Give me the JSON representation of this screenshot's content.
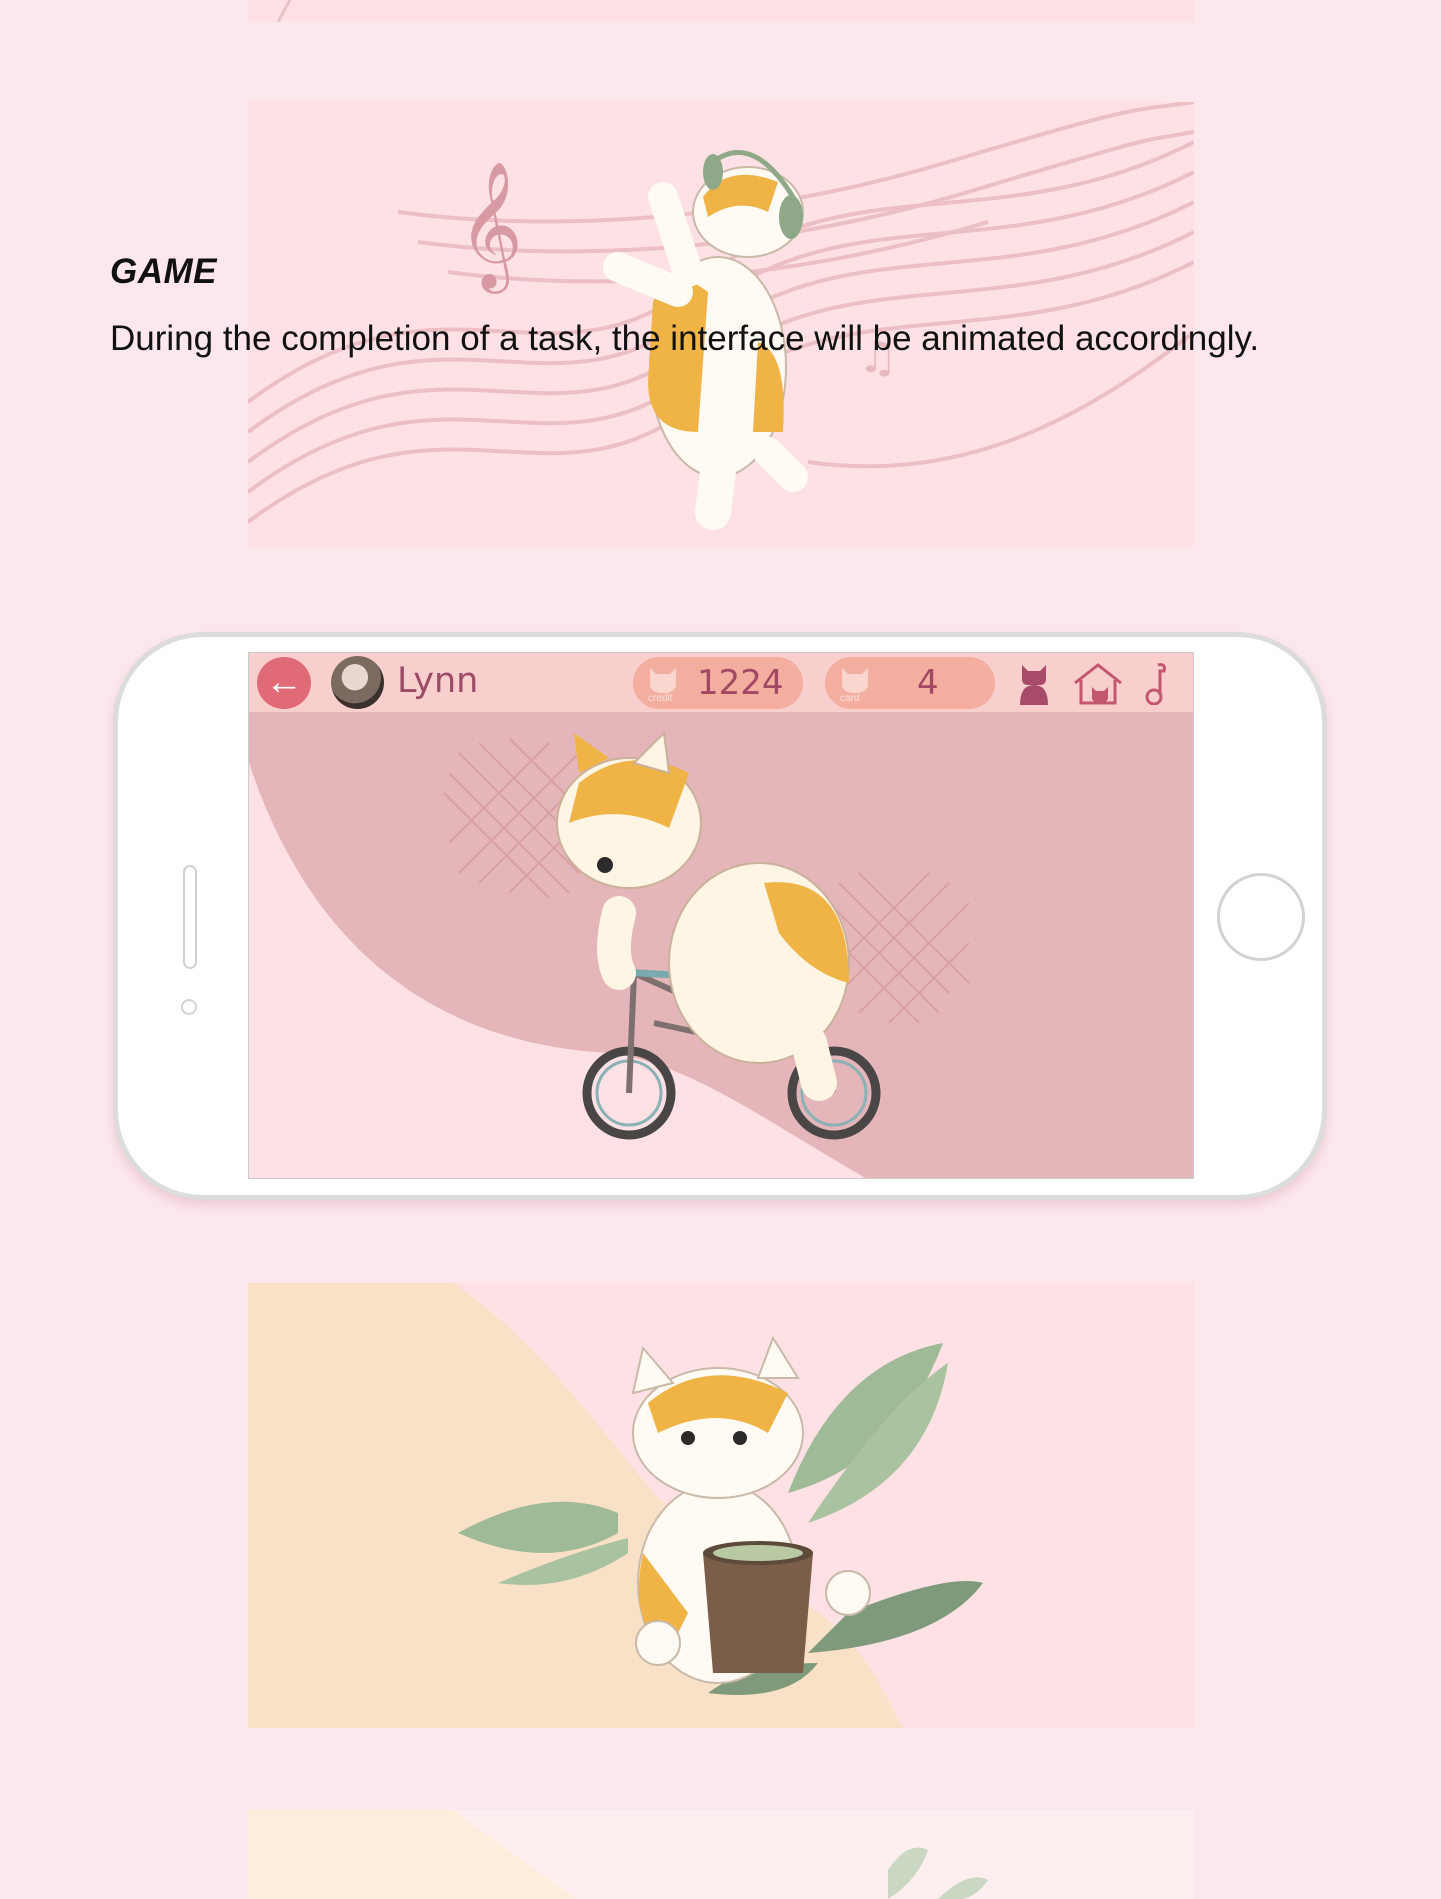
{
  "section": {
    "title": "GAME",
    "description": "During the completion of a task, the interface will be animated accordingly."
  },
  "game_screen": {
    "username": "Lynn",
    "credit": {
      "label": "credit",
      "value": "1224"
    },
    "card": {
      "label": "card",
      "value": "4"
    },
    "icons": [
      "back-arrow-icon",
      "cat-icon",
      "cat-house-icon",
      "music-note-icon"
    ]
  },
  "colors": {
    "page_bg": "#fce8ec",
    "panel_pink": "#fde1e5",
    "topbar": "#f8cfcc",
    "accent": "#e06b77",
    "text_accent": "#9b4d68",
    "peach": "#f9e1c7",
    "leaf_green": "#9fba97"
  }
}
